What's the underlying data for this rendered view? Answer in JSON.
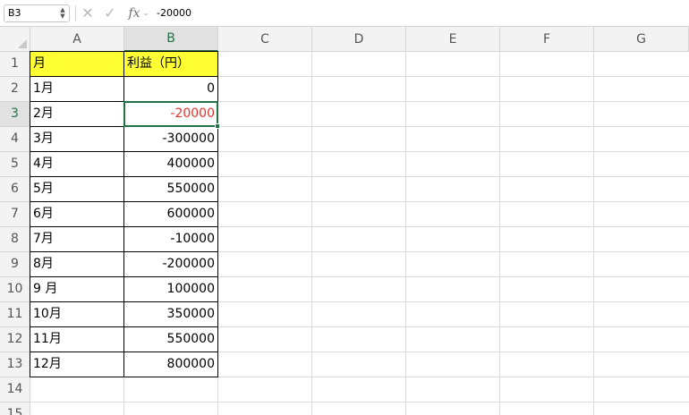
{
  "formula_bar": {
    "name_box": "B3",
    "stepper": "▲▼",
    "cancel_glyph": "✕",
    "enter_glyph": "✓",
    "fx_label": "fx",
    "fx_chevron": "⌄",
    "formula_value": "-20000"
  },
  "columns": [
    "A",
    "B",
    "C",
    "D",
    "E",
    "F",
    "G"
  ],
  "selected_column": "B",
  "rows": [
    "1",
    "2",
    "3",
    "4",
    "5",
    "6",
    "7",
    "8",
    "9",
    "10",
    "11",
    "12",
    "13",
    "14",
    "15"
  ],
  "selected_row": "3",
  "table": {
    "header": {
      "month": "月",
      "profit": "利益（円）",
      "fill_color": "#ffff33"
    },
    "records": [
      {
        "month": "1月",
        "profit": "0"
      },
      {
        "month": "2月",
        "profit": "-20000",
        "color": "#e8312a"
      },
      {
        "month": "3月",
        "profit": "-300000"
      },
      {
        "month": "4月",
        "profit": "400000"
      },
      {
        "month": "5月",
        "profit": "550000"
      },
      {
        "month": "6月",
        "profit": "600000"
      },
      {
        "month": "7月",
        "profit": "-10000"
      },
      {
        "month": "8月",
        "profit": "-200000"
      },
      {
        "month": "9 月",
        "profit": "100000"
      },
      {
        "month": "10月",
        "profit": "350000"
      },
      {
        "month": "11月",
        "profit": "550000"
      },
      {
        "month": "12月",
        "profit": "800000"
      }
    ]
  },
  "colors": {
    "selection_accent": "#217346",
    "negative_red": "#e8312a",
    "header_yellow": "#ffff33"
  }
}
